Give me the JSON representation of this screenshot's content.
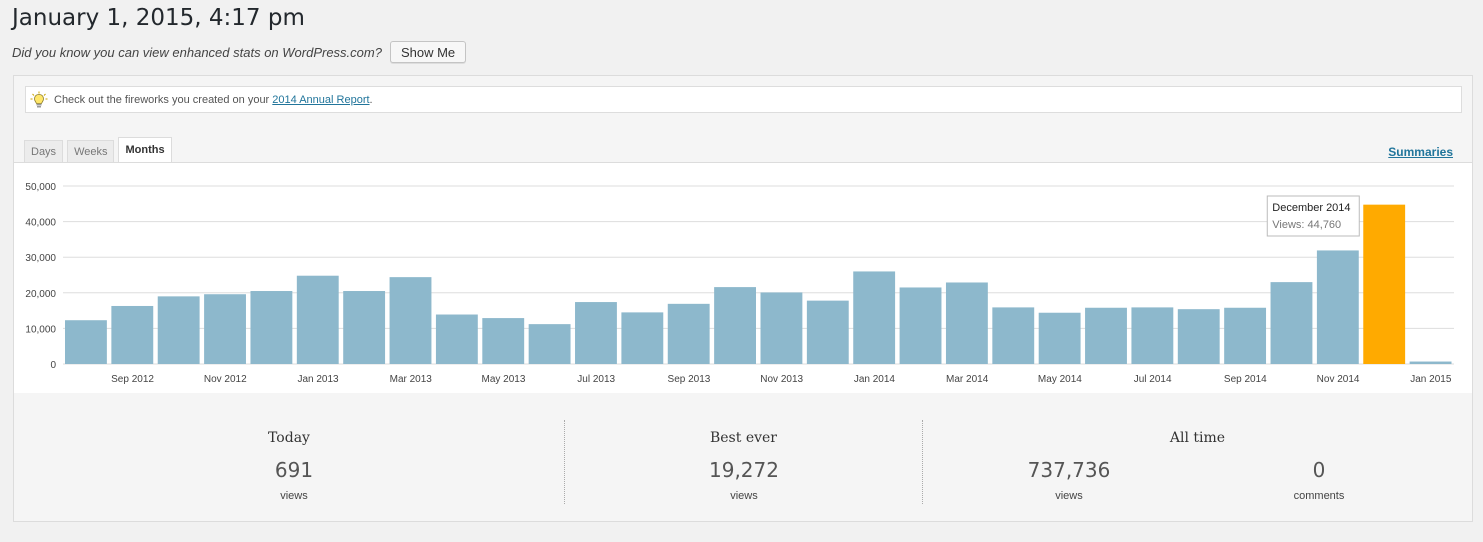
{
  "header": {
    "title": "January 1, 2015, 4:17 pm",
    "promo_text": "Did you know you can view enhanced stats on WordPress.com?",
    "show_me_label": "Show Me"
  },
  "notice": {
    "text_before": "Check out the fireworks you created on your ",
    "link_text": "2014 Annual Report",
    "text_after": ".",
    "icon": "lightbulb-icon"
  },
  "tabs": [
    {
      "label": "Days",
      "active": false
    },
    {
      "label": "Weeks",
      "active": false
    },
    {
      "label": "Months",
      "active": true
    }
  ],
  "summaries_label": "Summaries",
  "tooltip": {
    "title": "December 2014",
    "text": "Views: 44,760"
  },
  "stats": {
    "today": {
      "label": "Today",
      "value": "691",
      "unit": "views"
    },
    "best_ever": {
      "label": "Best ever",
      "value": "19,272",
      "unit": "views"
    },
    "all_time": {
      "label": "All time",
      "views_value": "737,736",
      "views_unit": "views",
      "comments_value": "0",
      "comments_unit": "comments"
    }
  },
  "chart_data": {
    "type": "bar",
    "x_tick_labels": [
      "Sep 2012",
      "Nov 2012",
      "Jan 2013",
      "Mar 2013",
      "May 2013",
      "Jul 2013",
      "Sep 2013",
      "Nov 2013",
      "Jan 2014",
      "Mar 2014",
      "May 2014",
      "Jul 2014",
      "Sep 2014",
      "Nov 2014",
      "Jan 2015"
    ],
    "categories": [
      "Aug 2012",
      "Sep 2012",
      "Oct 2012",
      "Nov 2012",
      "Dec 2012",
      "Jan 2013",
      "Feb 2013",
      "Mar 2013",
      "Apr 2013",
      "May 2013",
      "Jun 2013",
      "Jul 2013",
      "Aug 2013",
      "Sep 2013",
      "Oct 2013",
      "Nov 2013",
      "Dec 2013",
      "Jan 2014",
      "Feb 2014",
      "Mar 2014",
      "Apr 2014",
      "May 2014",
      "Jun 2014",
      "Jul 2014",
      "Aug 2014",
      "Sep 2014",
      "Oct 2014",
      "Nov 2014",
      "Dec 2014",
      "Jan 2015"
    ],
    "values": [
      12300,
      16300,
      19000,
      19600,
      20500,
      24800,
      20500,
      24400,
      13900,
      12900,
      11200,
      17400,
      14500,
      16900,
      21600,
      20100,
      17800,
      26000,
      21500,
      22900,
      15900,
      14400,
      15800,
      15900,
      15400,
      15800,
      23000,
      31900,
      44760,
      691
    ],
    "highlight_index": 28,
    "y_ticks": [
      "0",
      "10,000",
      "20,000",
      "30,000",
      "40,000",
      "50,000"
    ],
    "ylim": [
      0,
      50000
    ],
    "grid": true,
    "colors": {
      "bar": "#8db8cc",
      "highlight": "#ffaa00",
      "grid": "#dddddd"
    }
  }
}
